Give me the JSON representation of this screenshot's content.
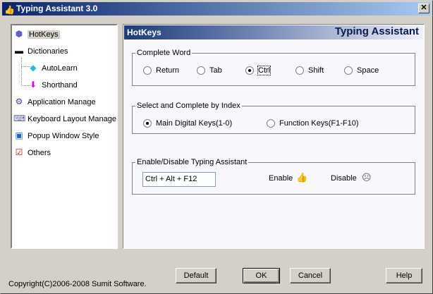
{
  "window": {
    "title": "Typing Assistant 3.0",
    "close": "✕"
  },
  "sidebar": {
    "items": [
      {
        "label": "HotKeys",
        "icon": "keys-icon"
      },
      {
        "label": "Dictionaries",
        "icon": "collapse-icon"
      },
      {
        "label": "AutoLearn",
        "icon": "book-icon"
      },
      {
        "label": "Shorthand",
        "icon": "shorthand-icon"
      },
      {
        "label": "Application Manage",
        "icon": "gear-icon"
      },
      {
        "label": "Keyboard Layout Manage",
        "icon": "keyboard-icon"
      },
      {
        "label": "Popup Window Style",
        "icon": "window-icon"
      },
      {
        "label": "Others",
        "icon": "checklist-icon"
      }
    ]
  },
  "panel": {
    "header_left": "HotKeys",
    "header_right": "Typing Assistant",
    "complete_word": {
      "legend": "Complete Word",
      "options": [
        "Return",
        "Tab",
        "Ctrl",
        "Shift",
        "Space"
      ],
      "selected": "Ctrl"
    },
    "index": {
      "legend": "Select and Complete by Index",
      "options": [
        "Main Digital Keys(1-0)",
        "Function Keys(F1-F10)"
      ],
      "selected": "Main Digital Keys(1-0)"
    },
    "toggle": {
      "legend": "Enable/Disable Typing Assistant",
      "hotkey": "Ctrl + Alt + F12",
      "enable": "Enable",
      "disable": "Disable"
    }
  },
  "footer": {
    "copyright": "Copyright(C)2006-2008 Sumit Software.",
    "default": "Default",
    "ok": "OK",
    "cancel": "Cancel",
    "help": "Help"
  }
}
